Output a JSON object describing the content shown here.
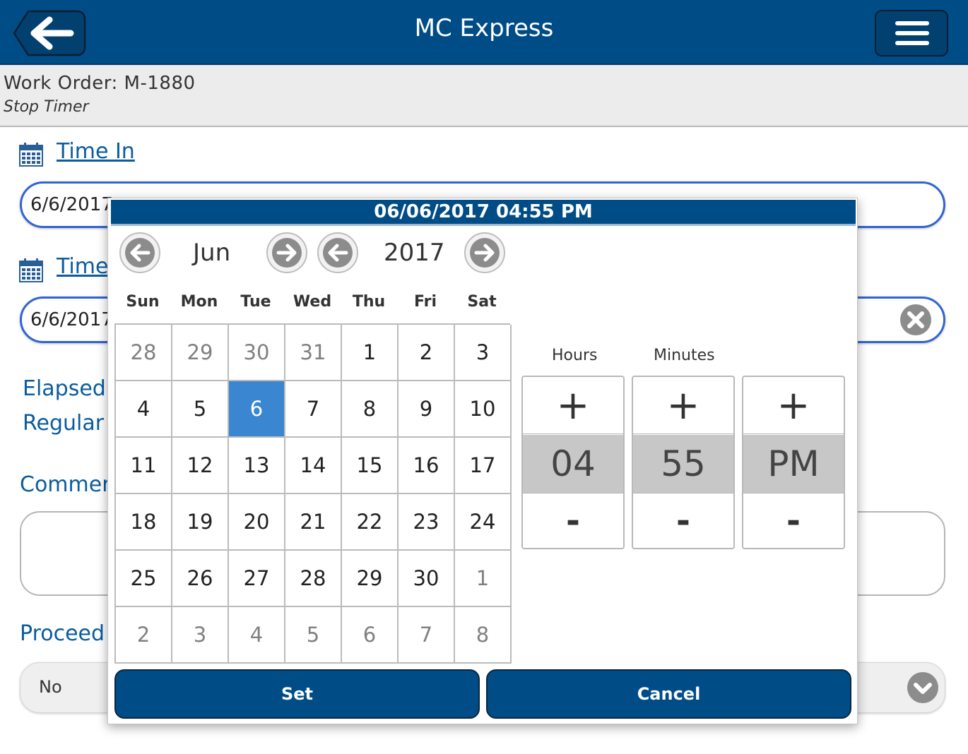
{
  "header": {
    "title": "MC Express",
    "back_icon": "arrow-left-icon",
    "menu_icon": "hamburger-icon"
  },
  "subheader": {
    "work_order": "Work Order: M-1880",
    "subtitle": "Stop Timer"
  },
  "form": {
    "time_in_label": "Time In",
    "time_in_value": "6/6/2017",
    "time_out_label": "Time",
    "time_out_value": "6/6/2017",
    "elapsed_label": "Elapsed",
    "regular_label": "Regular",
    "comments_label": "Commer",
    "proceed_label": "Proceed",
    "proceed_value": "No"
  },
  "picker": {
    "header": "06/06/2017 04:55 PM",
    "month": "Jun",
    "year": "2017",
    "weekdays": [
      "Sun",
      "Mon",
      "Tue",
      "Wed",
      "Thu",
      "Fri",
      "Sat"
    ],
    "days": [
      [
        "28",
        "29",
        "30",
        "31",
        "1",
        "2",
        "3"
      ],
      [
        "4",
        "5",
        "6",
        "7",
        "8",
        "9",
        "10"
      ],
      [
        "11",
        "12",
        "13",
        "14",
        "15",
        "16",
        "17"
      ],
      [
        "18",
        "19",
        "20",
        "21",
        "22",
        "23",
        "24"
      ],
      [
        "25",
        "26",
        "27",
        "28",
        "29",
        "30",
        "1"
      ],
      [
        "2",
        "3",
        "4",
        "5",
        "6",
        "7",
        "8"
      ]
    ],
    "selected_day": "6",
    "hours_label": "Hours",
    "minutes_label": "Minutes",
    "hours": "04",
    "minutes": "55",
    "ampm": "PM",
    "plus": "+",
    "minus": "-",
    "set_label": "Set",
    "cancel_label": "Cancel"
  },
  "colors": {
    "primary": "#004c86",
    "link": "#0a5c9e",
    "selected": "#3a86d1",
    "input_border": "#2f64d6"
  }
}
